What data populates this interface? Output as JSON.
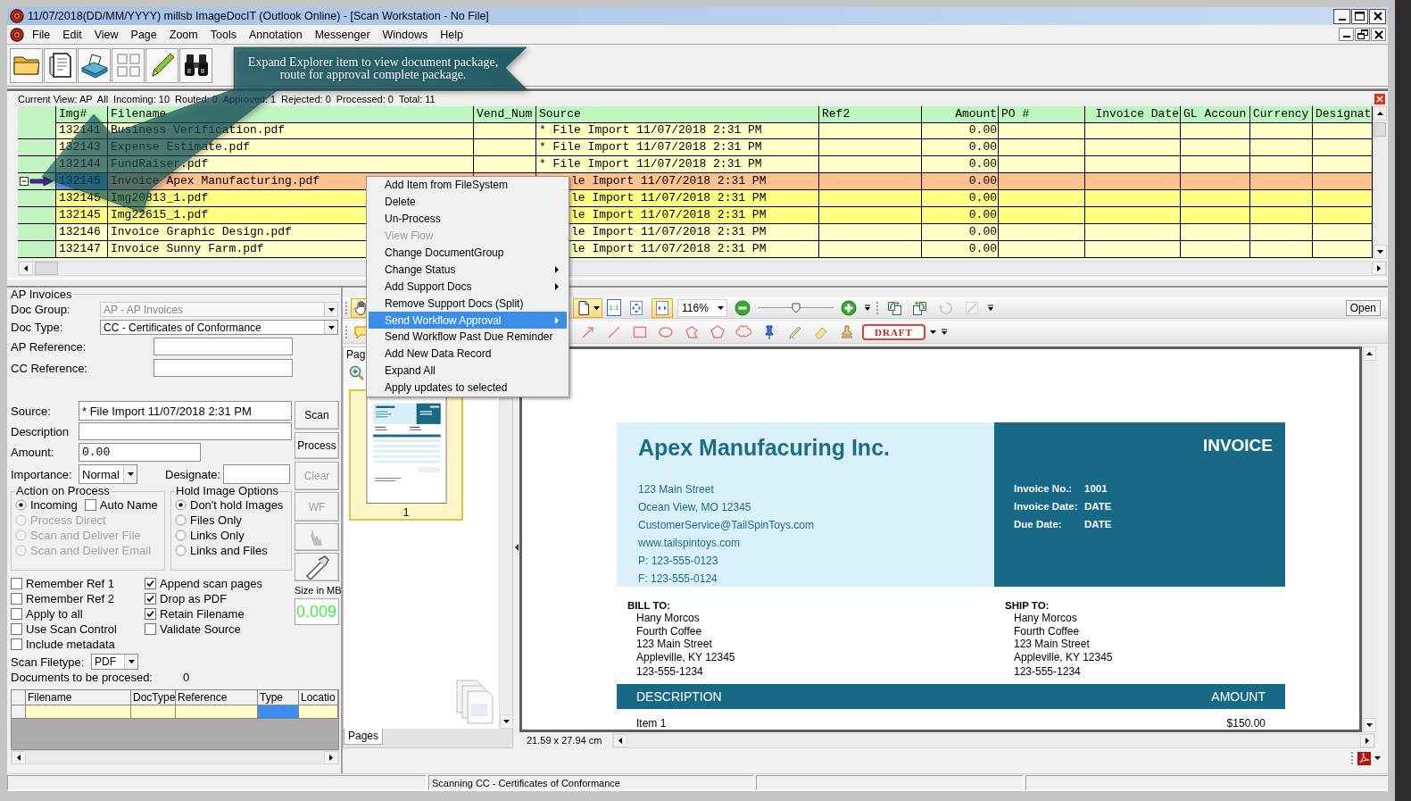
{
  "window": {
    "title": "11/07/2018(DD/MM/YYYY) millsb ImageDocIT (Outlook Online) - [Scan Workstation - No File]"
  },
  "menu": [
    "File",
    "Edit",
    "View",
    "Page",
    "Zoom",
    "Tools",
    "Annotation",
    "Messenger",
    "Windows",
    "Help"
  ],
  "toolbar": [
    {
      "kind": "folder",
      "disabled": false
    },
    {
      "kind": "document",
      "disabled": false
    },
    {
      "kind": "scanner",
      "disabled": false
    },
    {
      "kind": "grid",
      "disabled": true
    },
    {
      "kind": "pencil",
      "disabled": false
    },
    {
      "kind": "binoculars",
      "disabled": false
    }
  ],
  "explorer": {
    "summary": [
      "Current View: AP  All",
      "Incoming: 10",
      "Routed: 0",
      "Approved: 1",
      "Rejected: 0",
      "Processed: 0",
      "Total: 11"
    ],
    "columns": [
      "Img#",
      "Filename",
      "Vend_Num",
      "Source",
      "Ref2",
      "Amount",
      "PO #",
      "Invoice Date",
      "GL Accoun",
      "Currency",
      "Designat"
    ],
    "rows": [
      {
        "img": "132141",
        "filename": "Business Verification.pdf",
        "source": "* File Import 11/07/2018 2:31 PM",
        "amount": "0.00",
        "selected": false
      },
      {
        "img": "132143",
        "filename": "Expense Estimate.pdf",
        "source": "* File Import 11/07/2018 2:31 PM",
        "amount": "0.00",
        "selected": false
      },
      {
        "img": "132144",
        "filename": "FundRaiser.pdf",
        "source": "* File Import 11/07/2018 2:31 PM",
        "amount": "0.00",
        "selected": false
      },
      {
        "img": "132145",
        "filename": "Invoice Apex Manufacturing.pdf",
        "source": "le Import 11/07/2018 2:31 PM",
        "amount": "0.00",
        "selected": true,
        "expanded": true,
        "children": [
          {
            "img": "132145",
            "filename": "Img20813_1.pdf",
            "source": "le Import 11/07/2018 2:31 PM",
            "amount": "0.00",
            "selected": false
          },
          {
            "img": "132145",
            "filename": "Img22615_1.pdf",
            "source": "le Import 11/07/2018 2:31 PM",
            "amount": "0.00",
            "selected": false
          }
        ]
      },
      {
        "img": "132146",
        "filename": "Invoice Graphic Design.pdf",
        "source": "le Import 11/07/2018 2:31 PM",
        "amount": "0.00",
        "selected": false
      },
      {
        "img": "132147",
        "filename": "Invoice Sunny Farm.pdf",
        "source": "le Import 11/07/2018 2:31 PM",
        "amount": "0.00",
        "selected": false
      }
    ]
  },
  "callout": {
    "text": "Expand Explorer item to view document package, route for approval complete package."
  },
  "context_menu": {
    "items": [
      {
        "label": "Add Item from FileSystem",
        "disabled": false,
        "submenu": false,
        "selected": false
      },
      {
        "label": "Delete",
        "disabled": false,
        "submenu": false,
        "selected": false
      },
      {
        "label": "Un-Process",
        "disabled": false,
        "submenu": false,
        "selected": false
      },
      {
        "label": "View Flow",
        "disabled": true,
        "submenu": false,
        "selected": false
      },
      {
        "label": "Change DocumentGroup",
        "disabled": false,
        "submenu": false,
        "selected": false
      },
      {
        "label": "Change Status",
        "disabled": false,
        "submenu": true,
        "selected": false
      },
      {
        "label": "Add Support Docs",
        "disabled": false,
        "submenu": true,
        "selected": false
      },
      {
        "label": "Remove Support Docs (Split)",
        "disabled": false,
        "submenu": false,
        "selected": false
      },
      {
        "label": "Send Workflow Approval",
        "disabled": false,
        "submenu": true,
        "selected": true
      },
      {
        "label": "Send Workflow Past Due Reminder",
        "disabled": false,
        "submenu": false,
        "selected": false
      },
      {
        "label": "Add New Data Record",
        "disabled": false,
        "submenu": false,
        "selected": false
      },
      {
        "label": "Expand All",
        "disabled": false,
        "submenu": false,
        "selected": false
      },
      {
        "label": "Apply updates to selected",
        "disabled": false,
        "submenu": false,
        "selected": false
      }
    ]
  },
  "form": {
    "title": "AP Invoices",
    "doc_group": {
      "label": "Doc Group:",
      "value": "AP - AP Invoices",
      "disabled": true
    },
    "doc_type": {
      "label": "Doc Type:",
      "value": "CC - Certificates of Conformance",
      "disabled": false
    },
    "ap_reference": {
      "label": "AP Reference:"
    },
    "cc_reference": {
      "label": "CC Reference:"
    },
    "source": {
      "label": "Source:",
      "value": "* File Import 11/07/2018 2:31 PM"
    },
    "description": {
      "label": "Description"
    },
    "amount": {
      "label": "Amount:",
      "value": "0.00"
    },
    "importance": {
      "label": "Importance:",
      "value": "Normal"
    },
    "designate": {
      "label": "Designate:"
    },
    "action_on_process": {
      "title": "Action on Process",
      "options": [
        {
          "label": "Incoming",
          "selected": true,
          "disabled": false
        },
        {
          "label": "Process Direct",
          "selected": false,
          "disabled": true
        },
        {
          "label": "Scan and Deliver File",
          "selected": false,
          "disabled": true
        },
        {
          "label": "Scan and Deliver Email",
          "selected": false,
          "disabled": true
        }
      ],
      "auto_name": {
        "label": "Auto Name",
        "checked": false
      }
    },
    "hold_image_options": {
      "title": "Hold Image Options",
      "options": [
        {
          "label": "Don't hold Images",
          "selected": true
        },
        {
          "label": "Files Only",
          "selected": false
        },
        {
          "label": "Links Only",
          "selected": false
        },
        {
          "label": "Links and Files",
          "selected": false
        }
      ]
    },
    "side_buttons": [
      {
        "kind": "text",
        "label": "Scan",
        "disabled": false
      },
      {
        "kind": "text",
        "label": "Process",
        "disabled": false
      },
      {
        "kind": "text",
        "label": "Clear",
        "disabled": true
      },
      {
        "kind": "text",
        "label": "WF",
        "disabled": true
      },
      {
        "kind": "pointer",
        "disabled": true
      },
      {
        "kind": "pen",
        "disabled": false
      }
    ],
    "size": {
      "label": "Size in MB",
      "value": "0.009"
    },
    "options_left": [
      {
        "label": "Remember Ref 1",
        "checked": false
      },
      {
        "label": "Remember Ref 2",
        "checked": false
      },
      {
        "label": "Apply to all",
        "checked": false
      },
      {
        "label": "Use Scan Control",
        "checked": false
      },
      {
        "label": "Include metadata",
        "checked": false
      }
    ],
    "options_right": [
      {
        "label": "Append scan pages",
        "checked": true
      },
      {
        "label": "Drop as PDF",
        "checked": true
      },
      {
        "label": "Retain Filename",
        "checked": true
      },
      {
        "label": "Validate Source",
        "checked": false
      }
    ],
    "scan_filetype": {
      "label": "Scan Filetype:",
      "value": "PDF"
    },
    "documents": {
      "label": "Documents to be procesed:",
      "value": "0"
    },
    "queue": {
      "columns": [
        "Filename",
        "DocType",
        "Reference",
        "Type",
        "Locatio"
      ]
    }
  },
  "viewer": {
    "toolbar": {
      "hand": {
        "active": true
      },
      "view_buttons": [
        {
          "kind": "page",
          "active": true
        },
        {
          "kind": "actual-size",
          "label": "1:1",
          "active": false
        },
        {
          "kind": "fit-page",
          "active": false
        },
        {
          "kind": "fit-width",
          "active": true
        }
      ],
      "zoom": {
        "value": "116%",
        "level": 0.5
      },
      "rotate_buttons": [
        {
          "kind": "rotate-left",
          "disabled": false
        },
        {
          "kind": "rotate-right",
          "disabled": false
        },
        {
          "kind": "rotate",
          "disabled": true
        },
        {
          "kind": "edit",
          "disabled": true
        }
      ],
      "open_button": "Open"
    },
    "annotation_bar": {
      "note": {
        "active": false
      },
      "tools": [
        {
          "kind": "arrow"
        },
        {
          "kind": "line"
        },
        {
          "kind": "rectangle"
        },
        {
          "kind": "ellipse"
        },
        {
          "kind": "polygon"
        },
        {
          "kind": "pentagon"
        },
        {
          "kind": "cloud"
        },
        {
          "kind": "pin"
        },
        {
          "kind": "highlighter"
        },
        {
          "kind": "eraser"
        },
        {
          "kind": "stamp"
        }
      ],
      "stamp_label": "DRAFT"
    },
    "pages_panel": {
      "title": "Pag",
      "pages": [
        {
          "label": "1",
          "selected": true
        }
      ],
      "tabs": [
        {
          "label": "Pages",
          "selected": true
        }
      ]
    },
    "page_size": "21.59 x 27.94 cm",
    "document": {
      "company": "Apex Manufacuring Inc.",
      "address": [
        "123 Main Street",
        "Ocean View, MO 12345",
        "CustomerService@TailSpinToys.com",
        "www.tailspintoys.com",
        "P: 123-555-0123",
        "F: 123-555-0124"
      ],
      "title": "INVOICE",
      "details": [
        {
          "label": "Invoice No.:",
          "value": "1001"
        },
        {
          "label": "Invoice Date:",
          "value": "DATE"
        },
        {
          "label": "Due Date:",
          "value": "DATE"
        }
      ],
      "bill_to": {
        "heading": "BILL TO:",
        "lines": [
          "Hany Morcos",
          "Fourth Coffee",
          "123 Main Street",
          "Appleville, KY 12345",
          "123-555-1234"
        ]
      },
      "ship_to": {
        "heading": "SHIP TO:",
        "lines": [
          "Hany Morcos",
          "Fourth Coffee",
          "123 Main Street",
          "Appleville, KY 12345",
          "123-555-1234"
        ]
      },
      "columns": [
        "DESCRIPTION",
        "AMOUNT"
      ],
      "items": [
        {
          "description": "Item 1",
          "amount": "$150.00"
        }
      ]
    }
  },
  "status_bar": {
    "message": "Scanning CC - Certificates of Conformance"
  }
}
